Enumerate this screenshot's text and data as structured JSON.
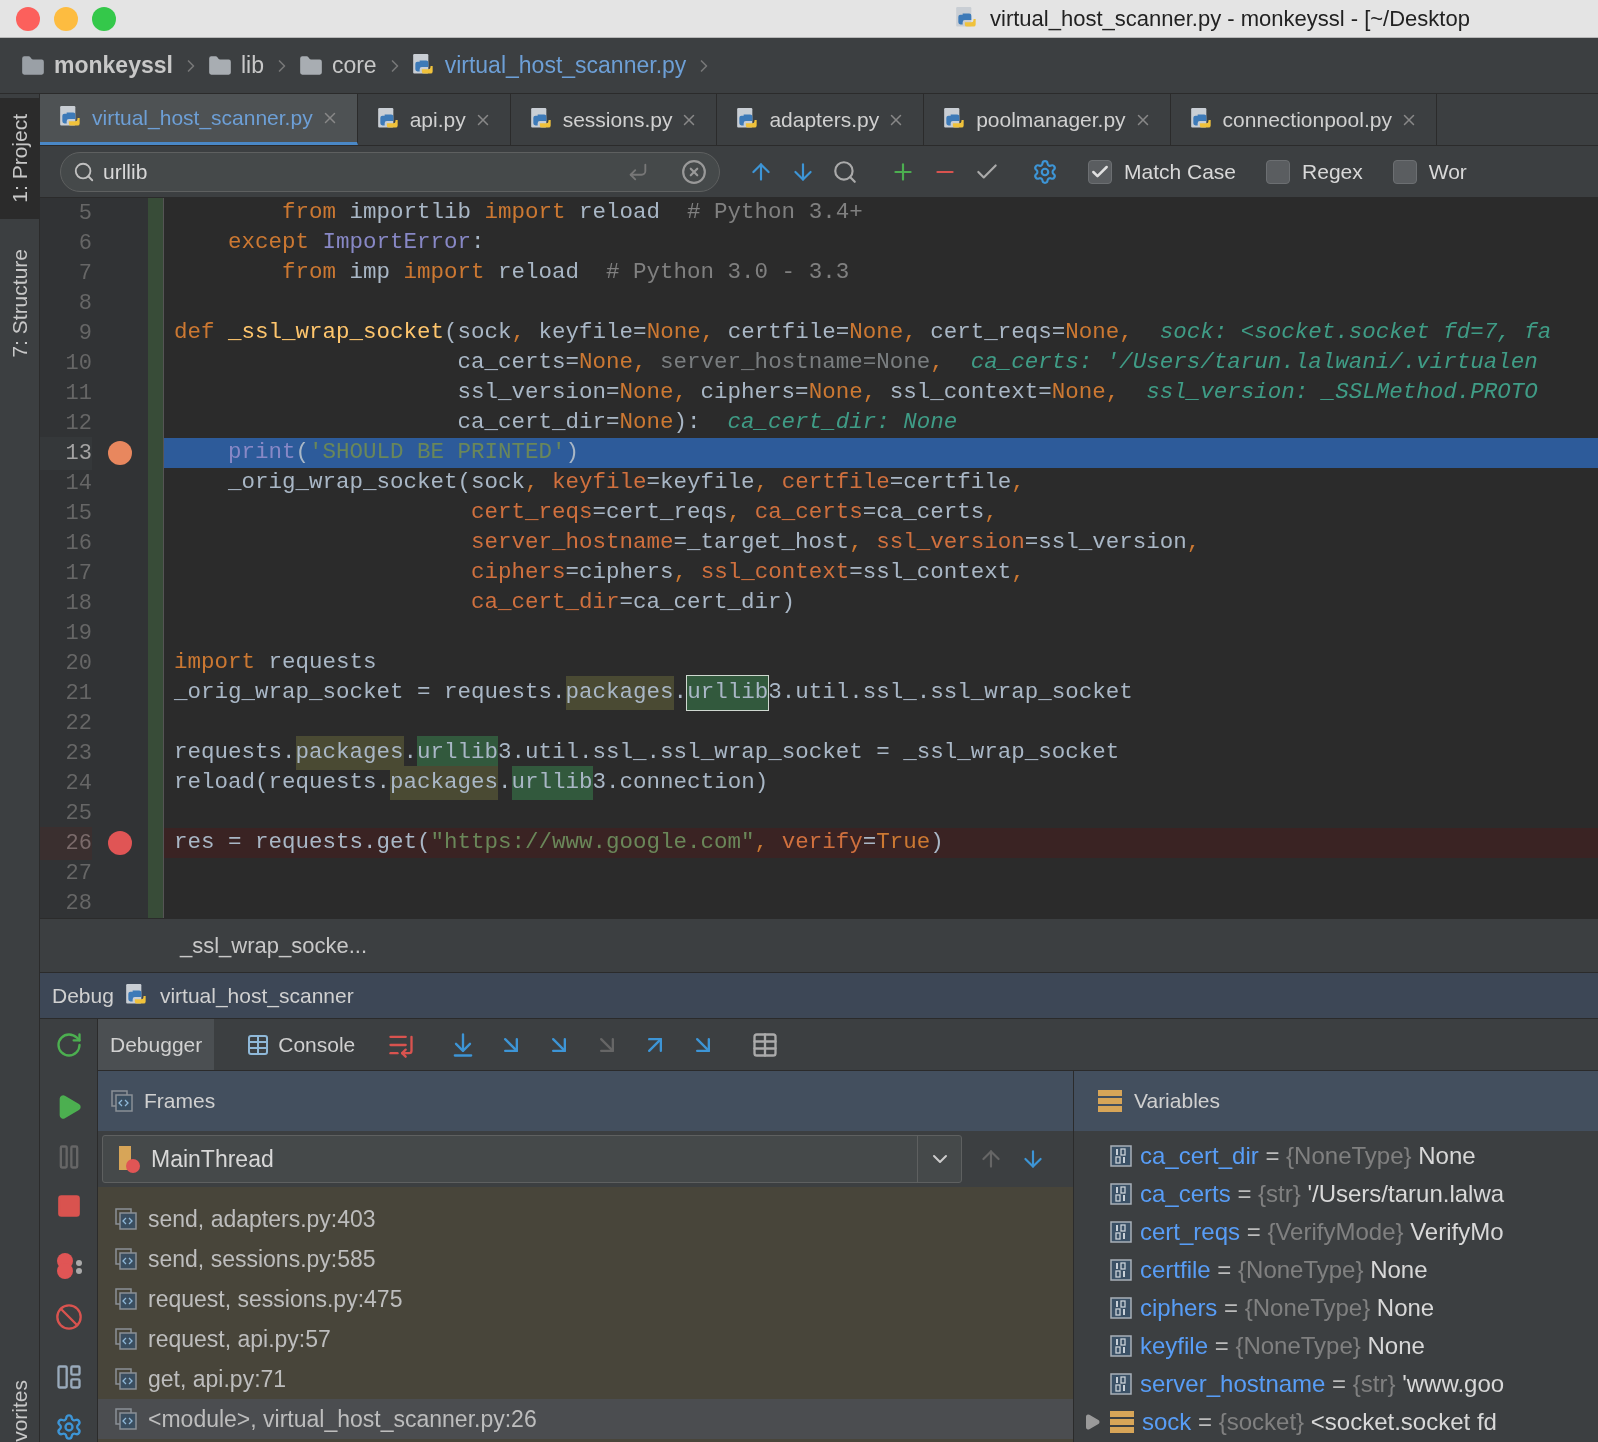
{
  "window": {
    "title": "virtual_host_scanner.py - monkeyssl - [~/Desktop"
  },
  "breadcrumbs": [
    {
      "label": "monkeyssl",
      "kind": "project"
    },
    {
      "label": "lib",
      "kind": "folder"
    },
    {
      "label": "core",
      "kind": "folder"
    },
    {
      "label": "virtual_host_scanner.py",
      "kind": "file"
    }
  ],
  "tool_strip": {
    "items": [
      {
        "label": "1: Project",
        "selected": true
      },
      {
        "label": "7: Structure",
        "selected": false
      }
    ],
    "bottom_label": "vorites"
  },
  "tabs": [
    {
      "label": "virtual_host_scanner.py",
      "selected": true
    },
    {
      "label": "api.py",
      "selected": false
    },
    {
      "label": "sessions.py",
      "selected": false
    },
    {
      "label": "adapters.py",
      "selected": false
    },
    {
      "label": "poolmanager.py",
      "selected": false
    },
    {
      "label": "connectionpool.py",
      "selected": false
    }
  ],
  "find": {
    "value": "urllib",
    "options": [
      {
        "label": "Match Case",
        "checked": true
      },
      {
        "label": "Regex",
        "checked": false
      },
      {
        "label": "Wor",
        "checked": false
      }
    ]
  },
  "editor": {
    "lines": [
      {
        "number": "5",
        "breakpoint": false,
        "current": false,
        "tokens": [
          {
            "text": "        from",
            "kind": "keyword"
          },
          {
            "text": " importlib ",
            "kind": "plain"
          },
          {
            "text": "import",
            "kind": "keyword"
          },
          {
            "text": " reload  ",
            "kind": "plain"
          },
          {
            "text": "# Python 3.4+",
            "kind": "comment"
          }
        ]
      },
      {
        "number": "6",
        "breakpoint": false,
        "current": false,
        "tokens": [
          {
            "text": "    except ",
            "kind": "keyword"
          },
          {
            "text": "ImportError",
            "kind": "builtin"
          },
          {
            "text": ":",
            "kind": "plain"
          }
        ]
      },
      {
        "number": "7",
        "breakpoint": false,
        "current": false,
        "tokens": [
          {
            "text": "        from",
            "kind": "keyword"
          },
          {
            "text": " imp ",
            "kind": "plain"
          },
          {
            "text": "import",
            "kind": "keyword"
          },
          {
            "text": " reload  ",
            "kind": "plain"
          },
          {
            "text": "# Python 3.0 - 3.3",
            "kind": "comment"
          }
        ]
      },
      {
        "number": "8",
        "breakpoint": false,
        "current": false
      },
      {
        "number": "9",
        "breakpoint": false,
        "current": false,
        "tokens": [
          {
            "text": "def",
            "kind": "keyword"
          },
          {
            "text": " _ssl_wrap_socket",
            "kind": "function"
          },
          {
            "text": "(sock",
            "kind": "plain"
          },
          {
            "text": ", ",
            "kind": "keyword"
          },
          {
            "text": "keyfile=",
            "kind": "plain"
          },
          {
            "text": "None",
            "kind": "keyword"
          },
          {
            "text": ", ",
            "kind": "keyword"
          },
          {
            "text": "certfile=",
            "kind": "plain"
          },
          {
            "text": "None",
            "kind": "keyword"
          },
          {
            "text": ", ",
            "kind": "keyword"
          },
          {
            "text": "cert_reqs=",
            "kind": "plain"
          },
          {
            "text": "None",
            "kind": "keyword"
          },
          {
            "text": ",",
            "kind": "keyword"
          },
          {
            "text": "  sock: <socket.socket fd=7, fa",
            "kind": "hint"
          }
        ]
      },
      {
        "number": "10",
        "breakpoint": false,
        "current": false,
        "tokens": [
          {
            "text": "                     ca_certs=",
            "kind": "plain"
          },
          {
            "text": "None",
            "kind": "keyword"
          },
          {
            "text": ", ",
            "kind": "keyword"
          },
          {
            "text": "server_hostname=None",
            "kind": "unused"
          },
          {
            "text": ",",
            "kind": "keyword"
          },
          {
            "text": "  ca_certs: '/Users/tarun.lalwani/.virtualen",
            "kind": "hint"
          }
        ]
      },
      {
        "number": "11",
        "breakpoint": false,
        "current": false,
        "tokens": [
          {
            "text": "                     ssl_version=",
            "kind": "plain"
          },
          {
            "text": "None",
            "kind": "keyword"
          },
          {
            "text": ", ",
            "kind": "keyword"
          },
          {
            "text": "ciphers=",
            "kind": "plain"
          },
          {
            "text": "None",
            "kind": "keyword"
          },
          {
            "text": ", ",
            "kind": "keyword"
          },
          {
            "text": "ssl_context=",
            "kind": "plain"
          },
          {
            "text": "None",
            "kind": "keyword"
          },
          {
            "text": ",",
            "kind": "keyword"
          },
          {
            "text": "  ssl_version: _SSLMethod.PROTO",
            "kind": "hint"
          }
        ]
      },
      {
        "number": "12",
        "breakpoint": false,
        "current": false,
        "tokens": [
          {
            "text": "                     ca_cert_dir=",
            "kind": "plain"
          },
          {
            "text": "None",
            "kind": "keyword"
          },
          {
            "text": "):",
            "kind": "plain"
          },
          {
            "text": "  ca_cert_dir: None",
            "kind": "hint"
          }
        ]
      },
      {
        "number": "13",
        "breakpoint": true,
        "current": true,
        "tokens": [
          {
            "text": "    print",
            "kind": "builtin"
          },
          {
            "text": "(",
            "kind": "plain"
          },
          {
            "text": "'SHOULD BE PRINTED'",
            "kind": "string"
          },
          {
            "text": ")",
            "kind": "plain"
          }
        ]
      },
      {
        "number": "14",
        "breakpoint": false,
        "current": false,
        "tokens": [
          {
            "text": "    _orig_wrap_socket(sock",
            "kind": "plain"
          },
          {
            "text": ", ",
            "kind": "keyword"
          },
          {
            "text": "keyfile",
            "kind": "named_arg"
          },
          {
            "text": "=keyfile",
            "kind": "plain"
          },
          {
            "text": ", ",
            "kind": "keyword"
          },
          {
            "text": "certfile",
            "kind": "named_arg"
          },
          {
            "text": "=certfile",
            "kind": "plain"
          },
          {
            "text": ",",
            "kind": "keyword"
          }
        ]
      },
      {
        "number": "15",
        "breakpoint": false,
        "current": false,
        "tokens": [
          {
            "text": "                      cert_reqs",
            "kind": "named_arg"
          },
          {
            "text": "=cert_reqs",
            "kind": "plain"
          },
          {
            "text": ", ",
            "kind": "keyword"
          },
          {
            "text": "ca_certs",
            "kind": "named_arg"
          },
          {
            "text": "=ca_certs",
            "kind": "plain"
          },
          {
            "text": ",",
            "kind": "keyword"
          }
        ]
      },
      {
        "number": "16",
        "breakpoint": false,
        "current": false,
        "tokens": [
          {
            "text": "                      server_hostname",
            "kind": "named_arg"
          },
          {
            "text": "=_target_host",
            "kind": "plain"
          },
          {
            "text": ", ",
            "kind": "keyword"
          },
          {
            "text": "ssl_version",
            "kind": "named_arg"
          },
          {
            "text": "=ssl_version",
            "kind": "plain"
          },
          {
            "text": ",",
            "kind": "keyword"
          }
        ]
      },
      {
        "number": "17",
        "breakpoint": false,
        "current": false,
        "tokens": [
          {
            "text": "                      ciphers",
            "kind": "named_arg"
          },
          {
            "text": "=ciphers",
            "kind": "plain"
          },
          {
            "text": ", ",
            "kind": "keyword"
          },
          {
            "text": "ssl_context",
            "kind": "named_arg"
          },
          {
            "text": "=ssl_context",
            "kind": "plain"
          },
          {
            "text": ",",
            "kind": "keyword"
          }
        ]
      },
      {
        "number": "18",
        "breakpoint": false,
        "current": false,
        "tokens": [
          {
            "text": "                      ca_cert_dir",
            "kind": "named_arg"
          },
          {
            "text": "=ca_cert_dir)",
            "kind": "plain"
          }
        ]
      },
      {
        "number": "19",
        "breakpoint": false,
        "current": false
      },
      {
        "number": "20",
        "breakpoint": false,
        "current": false,
        "tokens": [
          {
            "text": "import",
            "kind": "keyword"
          },
          {
            "text": " requests",
            "kind": "plain"
          }
        ]
      },
      {
        "number": "21",
        "breakpoint": false,
        "current": false,
        "tokens": [
          {
            "text": "_orig_wrap_socket = requests.",
            "kind": "plain"
          },
          {
            "text": "packages",
            "kind": "found"
          },
          {
            "text": ".",
            "kind": "plain"
          },
          {
            "text": "urllib",
            "kind": "current_match"
          },
          {
            "text": "3.util.ssl_.ssl_wrap_socket",
            "kind": "plain"
          }
        ]
      },
      {
        "number": "22",
        "breakpoint": false,
        "current": false
      },
      {
        "number": "23",
        "breakpoint": false,
        "current": false,
        "tokens": [
          {
            "text": "requests.",
            "kind": "plain"
          },
          {
            "text": "packages",
            "kind": "found"
          },
          {
            "text": ".",
            "kind": "plain"
          },
          {
            "text": "urllib",
            "kind": "match"
          },
          {
            "text": "3.util.ssl_.ssl_wrap_socket = _ssl_wrap_socket",
            "kind": "plain"
          }
        ]
      },
      {
        "number": "24",
        "breakpoint": false,
        "current": false,
        "tokens": [
          {
            "text": "reload(requests.",
            "kind": "plain"
          },
          {
            "text": "packages",
            "kind": "found"
          },
          {
            "text": ".",
            "kind": "plain"
          },
          {
            "text": "urllib",
            "kind": "match"
          },
          {
            "text": "3.connection)",
            "kind": "plain"
          }
        ]
      },
      {
        "number": "25",
        "breakpoint": false,
        "current": false
      },
      {
        "number": "26",
        "breakpoint": true,
        "current": false,
        "tokens": [
          {
            "text": "res = requests.get(",
            "kind": "plain"
          },
          {
            "text": "\"https://www.google.com\"",
            "kind": "string"
          },
          {
            "text": ", ",
            "kind": "keyword"
          },
          {
            "text": "verify",
            "kind": "named_arg"
          },
          {
            "text": "=",
            "kind": "plain"
          },
          {
            "text": "True",
            "kind": "keyword"
          },
          {
            "text": ")",
            "kind": "plain"
          }
        ]
      },
      {
        "number": "27",
        "breakpoint": false,
        "current": false
      },
      {
        "number": "28",
        "breakpoint": false,
        "current": false
      }
    ],
    "footer": "_ssl_wrap_socke..."
  },
  "debug": {
    "label": "Debug",
    "config": "virtual_host_scanner",
    "tabs": [
      {
        "label": "Debugger",
        "selected": true
      },
      {
        "label": "Console",
        "selected": false
      }
    ],
    "frames": {
      "title": "Frames",
      "thread": "MainThread",
      "items": [
        {
          "label": "send, adapters.py:403",
          "selected": false
        },
        {
          "label": "send, sessions.py:585",
          "selected": false
        },
        {
          "label": "request, sessions.py:475",
          "selected": false
        },
        {
          "label": "request, api.py:57",
          "selected": false
        },
        {
          "label": "get, api.py:71",
          "selected": false
        },
        {
          "label": "<module>, virtual_host_scanner.py:26",
          "selected": true
        }
      ]
    },
    "variables": {
      "title": "Variables",
      "items": [
        {
          "kind": "field",
          "name": "ca_cert_dir",
          "sep": "=",
          "type": "{NoneType}",
          "value": "None"
        },
        {
          "kind": "field",
          "name": "ca_certs",
          "sep": "=",
          "type": "{str}",
          "value": "'/Users/tarun.lalwa"
        },
        {
          "kind": "field",
          "name": "cert_reqs",
          "sep": "=",
          "type": "{VerifyMode}",
          "value": "VerifyMo"
        },
        {
          "kind": "field",
          "name": "certfile",
          "sep": "=",
          "type": "{NoneType}",
          "value": "None"
        },
        {
          "kind": "field",
          "name": "ciphers",
          "sep": "=",
          "type": "{NoneType}",
          "value": "None"
        },
        {
          "kind": "field",
          "name": "keyfile",
          "sep": "=",
          "type": "{NoneType}",
          "value": "None"
        },
        {
          "kind": "field",
          "name": "server_hostname",
          "sep": "=",
          "type": "{str}",
          "value": "'www.goo"
        },
        {
          "kind": "object",
          "name": "sock",
          "sep": "=",
          "type": "{socket}",
          "value": "<socket.socket fd"
        }
      ]
    }
  }
}
